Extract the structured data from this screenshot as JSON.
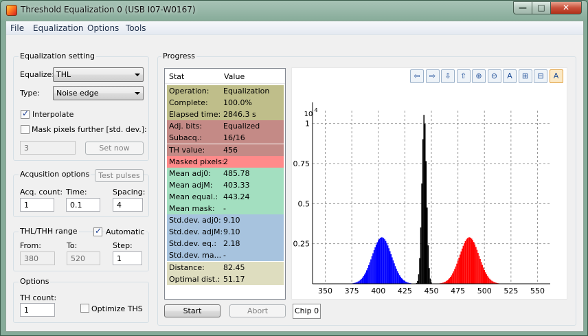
{
  "window": {
    "title": "Threshold Equalization 0 (USB I07-W0167)",
    "min_symbol": "—",
    "max_symbol": "□",
    "close_symbol": "✕",
    "icon": "app-logo-icon"
  },
  "menu": [
    "File",
    "Equalization",
    "Options",
    "Tools"
  ],
  "equalization": {
    "group_title": "Equalization setting",
    "equalize_label": "Equalize:",
    "equalize_value": "THL",
    "type_label": "Type:",
    "type_value": "Noise edge",
    "interpolate_label": "Interpolate",
    "interpolate_checked": true,
    "mask_label": "Mask pixels further [std. dev.]:",
    "mask_checked": false,
    "mask_value": "3",
    "set_now_label": "Set now"
  },
  "acquisition": {
    "group_title": "Acqusition options",
    "test_pulses_label": "Test pulses",
    "count_label": "Acq. count:",
    "count_value": "1",
    "time_label": "Time:",
    "time_value": "0.1",
    "spacing_label": "Spacing:",
    "spacing_value": "4"
  },
  "thl_range": {
    "group_title": "THL/THH range",
    "automatic_label": "Automatic",
    "automatic_checked": true,
    "from_label": "From:",
    "from_value": "380",
    "to_label": "To:",
    "to_value": "520",
    "step_label": "Step:",
    "step_value": "1"
  },
  "options": {
    "group_title": "Options",
    "th_count_label": "TH count:",
    "th_count_value": "1",
    "optimize_label": "Optimize THS",
    "optimize_checked": false
  },
  "progress": {
    "group_title": "Progress",
    "col_stat": "Stat",
    "col_value": "Value",
    "rows": [
      {
        "k": "Operation:",
        "v": "Equalization",
        "color": "#bfbe8a"
      },
      {
        "k": "Complete:",
        "v": "100.0%",
        "color": "#bfbe8a"
      },
      {
        "k": "Elapsed time:",
        "v": "2846.3 s",
        "color": "#bfbe8a"
      },
      {
        "k": "Adj. bits:",
        "v": "Equalized",
        "color": "#c48a86"
      },
      {
        "k": "Subacq.:",
        "v": "16/16",
        "color": "#c48a86"
      },
      {
        "k": "TH value:",
        "v": "456",
        "color": "#c48a86"
      },
      {
        "k": "Masked pixels:",
        "v": "2",
        "color": "#ff8a8a"
      },
      {
        "k": "Mean adj0:",
        "v": "485.78",
        "color": "#a3dfc0"
      },
      {
        "k": "Mean adjM:",
        "v": "403.33",
        "color": "#a3dfc0"
      },
      {
        "k": "Mean equal.:",
        "v": "443.24",
        "color": "#a3dfc0"
      },
      {
        "k": "Mean mask:",
        "v": "-",
        "color": "#a3dfc0"
      },
      {
        "k": "Std.dev. adj0:",
        "v": "9.10",
        "color": "#a7c3de"
      },
      {
        "k": "Std.dev. adjM:",
        "v": "9.10",
        "color": "#a7c3de"
      },
      {
        "k": "Std.dev. eq.:",
        "v": "2.18",
        "color": "#a7c3de"
      },
      {
        "k": "Std.dev. ma...",
        "v": "-",
        "color": "#a7c3de"
      },
      {
        "k": "Distance:",
        "v": "82.45",
        "color": "#deddbf"
      },
      {
        "k": "Optimal dist.:",
        "v": "51.17",
        "color": "#deddbf"
      }
    ],
    "start_label": "Start",
    "abort_label": "Abort",
    "tab_label": "Chip 0"
  },
  "toolbar_icons": [
    "arrow-left-icon",
    "arrow-right-icon",
    "arrow-down-icon",
    "arrow-up-icon",
    "zoom-in-icon",
    "zoom-out-icon",
    "autoscale-icon",
    "zoom-fit-icon",
    "zoom-reset-icon",
    "axis-scale-icon"
  ],
  "chart_data": {
    "type": "bar",
    "title": "",
    "xlabel": "",
    "ylabel": "",
    "y_exponent_label": "10",
    "y_exponent_sup": "4",
    "xlim": [
      338,
      562
    ],
    "ylim": [
      0,
      1.08
    ],
    "xticks": [
      350,
      375,
      400,
      425,
      450,
      475,
      500,
      525,
      550
    ],
    "yticks": [
      0.25,
      0.5,
      0.75,
      1
    ],
    "ytick_labels": [
      "0.25",
      "0.5",
      "0.75",
      "1"
    ],
    "grid": true,
    "series": [
      {
        "color": "#0000ff",
        "center": 403.33,
        "sigma": 9.1,
        "peak": 0.29
      },
      {
        "color": "#000000",
        "center": 443.24,
        "sigma": 2.18,
        "peak": 1.06
      },
      {
        "color": "#ff0000",
        "center": 485.78,
        "sigma": 9.1,
        "peak": 0.29
      }
    ]
  }
}
